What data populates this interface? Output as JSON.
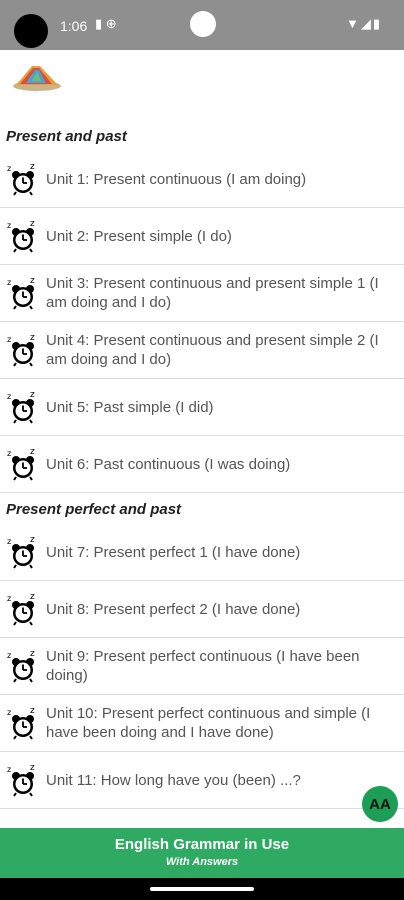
{
  "status_bar": {
    "time": "1:06",
    "left_icons": "▮ ⊕",
    "right_icons": "▼◢▮"
  },
  "sections": [
    {
      "title": "Present and past",
      "items": [
        "Unit 1: Present continuous (I am doing)",
        "Unit 2: Present simple (I do)",
        "Unit 3: Present continuous and present simple 1 (I am doing and I do)",
        "Unit 4: Present continuous and present simple 2 (I am doing and I do)",
        "Unit 5: Past simple (I did)",
        "Unit 6: Past continuous (I was doing)"
      ]
    },
    {
      "title": "Present perfect and past",
      "items": [
        "Unit 7: Present perfect 1 (I have done)",
        "Unit 8: Present perfect 2 (I have done)",
        "Unit 9: Present perfect continuous (I have been doing)",
        "Unit 10: Present perfect continuous and simple (I have been doing and I have done)",
        "Unit 11: How long have you (been) ...?"
      ]
    }
  ],
  "fab": {
    "label": "AA",
    "icon": "font-size-icon"
  },
  "bottom_bar": {
    "title": "English Grammar in Use",
    "subtitle": "With Answers"
  }
}
